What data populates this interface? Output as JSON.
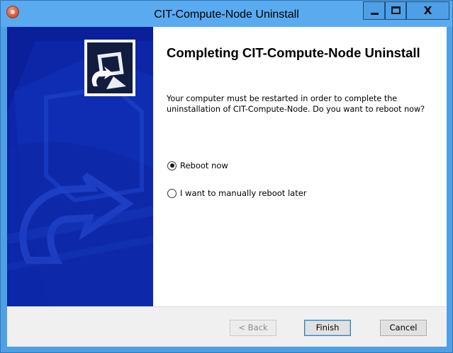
{
  "window": {
    "title": "CIT-Compute-Node Uninstall",
    "controls": {
      "minimize": "_",
      "maximize": "□",
      "close": "X"
    },
    "accent_color": "#5aaaf0"
  },
  "main": {
    "heading": "Completing CIT-Compute-Node Uninstall",
    "description": "Your computer must be restarted in order to complete the uninstallation of CIT-Compute-Node. Do you want to reboot now?",
    "options": [
      {
        "label": "Reboot now",
        "selected": true
      },
      {
        "label": "I want to manually reboot later",
        "selected": false
      }
    ]
  },
  "buttons": {
    "back": "< Back",
    "finish": "Finish",
    "cancel": "Cancel"
  }
}
